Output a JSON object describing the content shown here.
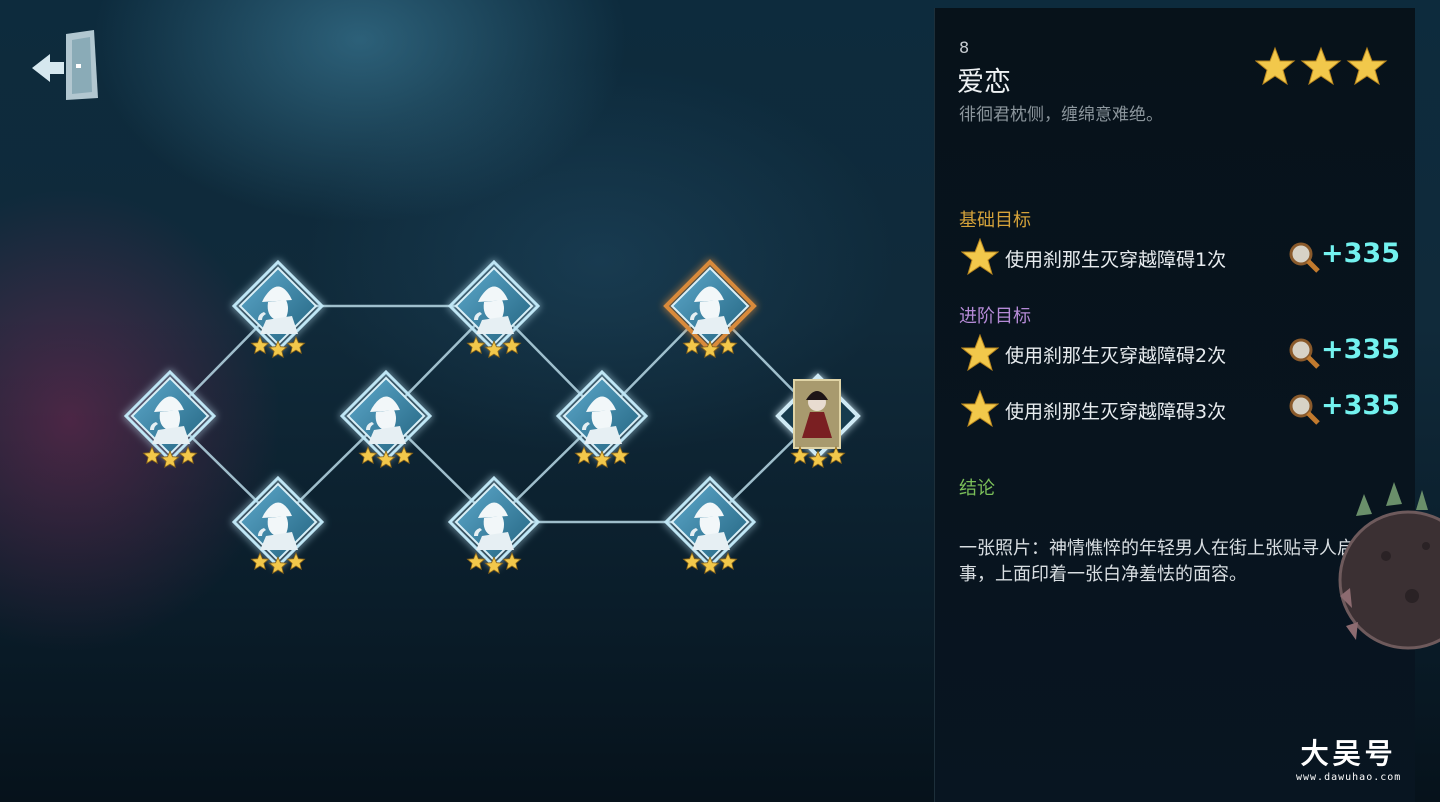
{
  "exit_button": {
    "icon": "exit-door-icon"
  },
  "map": {
    "nodes": [
      {
        "id": "n1",
        "icon": "detective-silhouette-icon",
        "stars": 3,
        "highlighted": false
      },
      {
        "id": "n2",
        "icon": "detective-silhouette-icon",
        "stars": 3,
        "highlighted": false
      },
      {
        "id": "n3",
        "icon": "detective-silhouette-icon",
        "stars": 3,
        "highlighted": false
      },
      {
        "id": "n4",
        "icon": "detective-silhouette-icon",
        "stars": 3,
        "highlighted": false
      },
      {
        "id": "n5",
        "icon": "detective-silhouette-icon",
        "stars": 3,
        "highlighted": false
      },
      {
        "id": "n6",
        "icon": "detective-silhouette-icon",
        "stars": 3,
        "highlighted": false
      },
      {
        "id": "n7",
        "icon": "detective-silhouette-icon",
        "stars": 3,
        "highlighted": false
      },
      {
        "id": "n8",
        "icon": "detective-silhouette-icon",
        "stars": 3,
        "highlighted": true
      },
      {
        "id": "n9",
        "icon": "detective-silhouette-icon",
        "stars": 3,
        "highlighted": false
      },
      {
        "id": "n10",
        "icon": "character-portrait-icon",
        "stars": 3,
        "highlighted": false
      }
    ],
    "edges": [
      [
        "n1",
        "n2"
      ],
      [
        "n1",
        "n3"
      ],
      [
        "n2",
        "n4"
      ],
      [
        "n3",
        "n4"
      ],
      [
        "n4",
        "n5"
      ],
      [
        "n4",
        "n6"
      ],
      [
        "n5",
        "n6"
      ],
      [
        "n6",
        "n7"
      ],
      [
        "n7",
        "n8"
      ],
      [
        "n8",
        "n10"
      ],
      [
        "n6",
        "n9"
      ],
      [
        "n9",
        "n10"
      ]
    ]
  },
  "panel": {
    "level": "8",
    "title": "爱恋",
    "subtitle": "徘徊君枕侧，缠绵意难绝。",
    "stars_earned": 3,
    "sections": {
      "basic": "基础目标",
      "advanced": "进阶目标",
      "conclusion": "结论"
    },
    "goals": [
      {
        "text": "使用刹那生灭穿越障碍1次",
        "reward": "+335",
        "icon": "magnifier-icon"
      },
      {
        "text": "使用刹那生灭穿越障碍2次",
        "reward": "+335",
        "icon": "magnifier-icon"
      },
      {
        "text": "使用刹那生灭穿越障碍3次",
        "reward": "+335",
        "icon": "magnifier-icon"
      }
    ],
    "conclusion_text": "一张照片：神情憔悴的年轻男人在街上张贴寻人启事，上面印着一张白净羞怯的面容。"
  },
  "watermark": {
    "main": "大吴号",
    "sub": "www.dawuhao.com"
  },
  "colors": {
    "star": "#f2c84b",
    "reward": "#73f2ef",
    "node_glow": "#bfe6f5",
    "highlight": "#d98a3a"
  }
}
